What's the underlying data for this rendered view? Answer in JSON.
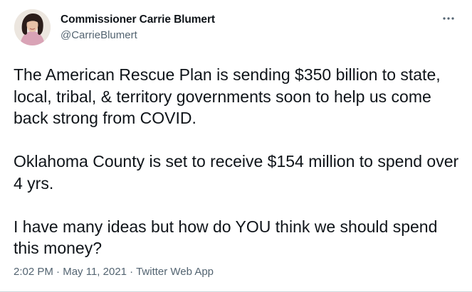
{
  "author": {
    "display_name": "Commissioner Carrie Blumert",
    "handle": "@CarrieBlumert",
    "avatar_icon": "profile-photo"
  },
  "more_icon": "more-horizontal-icon",
  "tweet": {
    "paragraphs": [
      "The American Rescue Plan is sending $350 billion to state, local, tribal, & territory governments soon to help us come back strong from COVID.",
      "Oklahoma County is set to receive $154 million to spend over 4 yrs.",
      "I have many ideas but how do YOU think we should spend this money?"
    ]
  },
  "meta": {
    "time": "2:02 PM",
    "separator": " · ",
    "date": "May 11, 2021",
    "source": "Twitter Web App"
  },
  "colors": {
    "text": "#0f1419",
    "secondary": "#536471",
    "divider": "#cfd9de"
  }
}
